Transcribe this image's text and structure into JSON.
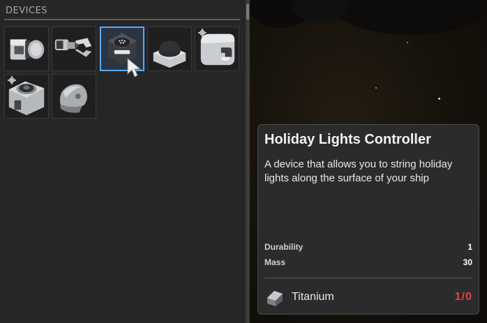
{
  "panel": {
    "title": "DEVICES",
    "devices": [
      {
        "name": "cylinder-tank-device",
        "selected": false,
        "gear": false
      },
      {
        "name": "grabber-claw-device",
        "selected": false,
        "gear": false
      },
      {
        "name": "holiday-lights-controller-device",
        "selected": true,
        "gear": false
      },
      {
        "name": "dome-button-device",
        "selected": false,
        "gear": false
      },
      {
        "name": "bent-pipe-device",
        "selected": false,
        "gear": true
      },
      {
        "name": "round-panel-device",
        "selected": false,
        "gear": true
      },
      {
        "name": "cap-sensor-device",
        "selected": false,
        "gear": false
      }
    ]
  },
  "tooltip": {
    "title": "Holiday Lights Controller",
    "description": "A device that allows you to string holiday lights along the surface of your ship",
    "stats": [
      {
        "label": "Durability",
        "value": "1"
      },
      {
        "label": "Mass",
        "value": "30"
      }
    ],
    "material": {
      "name": "Titanium",
      "count": "1/0",
      "icon": "titanium-ingot-icon"
    }
  },
  "colors": {
    "selected_border": "#5aa8ff",
    "insufficient": "#e54545"
  }
}
